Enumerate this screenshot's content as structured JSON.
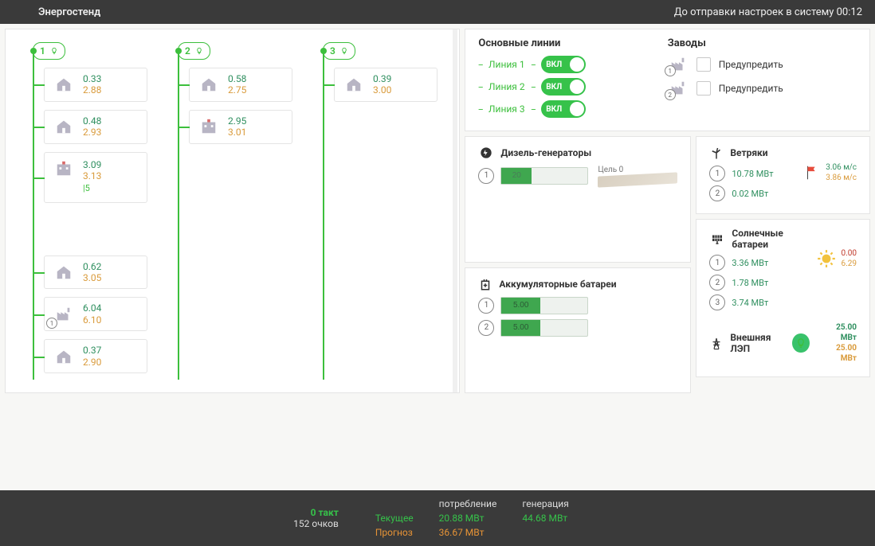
{
  "app": {
    "title": "Энергостенд",
    "countdown_label": "До отправки настроек в систему",
    "countdown_value": "00:12"
  },
  "lines": [
    {
      "id": "1",
      "nodes": [
        {
          "icon": "house",
          "v1": "0.33",
          "v2": "2.88"
        },
        {
          "icon": "house",
          "v1": "0.48",
          "v2": "2.93"
        },
        {
          "icon": "hospital",
          "v1": "3.09",
          "v2": "3.13",
          "extra": "|5"
        },
        {
          "gap": true
        },
        {
          "icon": "house",
          "v1": "0.62",
          "v2": "3.05"
        },
        {
          "icon": "factory",
          "v1": "6.04",
          "v2": "6.10",
          "badge": "1"
        },
        {
          "icon": "house",
          "v1": "0.37",
          "v2": "2.90"
        }
      ]
    },
    {
      "id": "2",
      "nodes": [
        {
          "icon": "house",
          "v1": "0.58",
          "v2": "2.75"
        },
        {
          "icon": "hospital",
          "v1": "2.95",
          "v2": "3.01"
        }
      ]
    },
    {
      "id": "3",
      "nodes": [
        {
          "icon": "house",
          "v1": "0.39",
          "v2": "3.00"
        }
      ]
    }
  ],
  "main_lines": {
    "title": "Основные линии",
    "items": [
      {
        "label": "Линия 1",
        "state": "ВКЛ"
      },
      {
        "label": "Линия 2",
        "state": "ВКЛ"
      },
      {
        "label": "Линия 3",
        "state": "ВКЛ"
      }
    ]
  },
  "factories": {
    "title": "Заводы",
    "items": [
      {
        "badge": "1",
        "warn": "Предупредить"
      },
      {
        "badge": "2",
        "warn": "Предупредить"
      }
    ]
  },
  "diesel": {
    "title": "Дизель-генераторы",
    "items": [
      {
        "id": "1",
        "value": "20",
        "target_label": "Цель 0"
      }
    ]
  },
  "batteries": {
    "title": "Аккумуляторные батареи",
    "items": [
      {
        "id": "1",
        "value": "5.00"
      },
      {
        "id": "2",
        "value": "5.00"
      }
    ]
  },
  "wind": {
    "title": "Ветряки",
    "items": [
      {
        "id": "1",
        "value": "10.78 МВт"
      },
      {
        "id": "2",
        "value": "0.02 МВт"
      }
    ],
    "meta1": "3.06 м/с",
    "meta2": "3.86 м/с"
  },
  "solar": {
    "title": "Солнечные батареи",
    "items": [
      {
        "id": "1",
        "value": "3.36 МВт"
      },
      {
        "id": "2",
        "value": "1.78 МВт"
      },
      {
        "id": "3",
        "value": "3.74 МВт"
      }
    ],
    "meta1": "0.00",
    "meta2": "6.29"
  },
  "lep": {
    "title": "Внешняя ЛЭП",
    "v1": "25.00 МВт",
    "v2": "25.00 МВт"
  },
  "footer": {
    "tact": "0 такт",
    "score": "152 очков",
    "col_current": "Текущее",
    "col_forecast": "Прогноз",
    "col_cons": "потребление",
    "col_gen": "генерация",
    "cons_now": "20.88 МВт",
    "gen_now": "44.68 МВт",
    "cons_fc": "36.67 МВт"
  }
}
